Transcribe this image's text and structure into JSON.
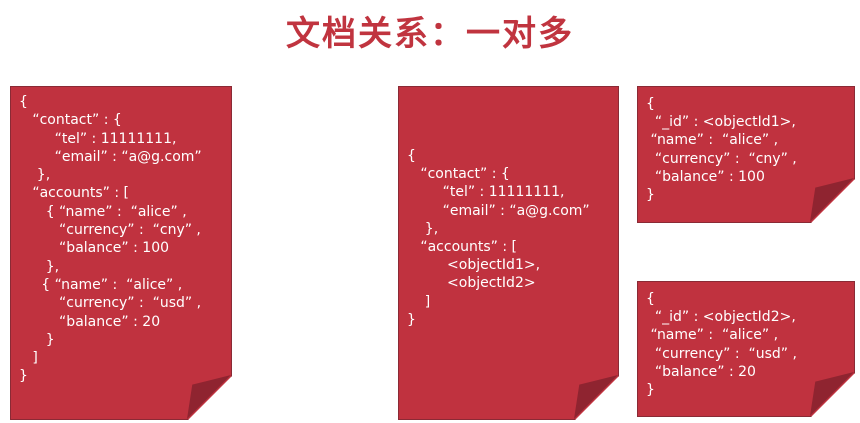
{
  "title": "文档关系：一对多",
  "colors": {
    "card": "#c0323f",
    "title": "#c0343f",
    "fold": "#8f2430"
  },
  "embedded_doc": {
    "lines": [
      "{",
      "   “contact” : {",
      "        “tel” : 11111111,",
      "        “email” : “a@g.com”",
      "    },",
      "   “accounts” : [",
      "      { “name” :  “alice” ,",
      "         “currency” :  “cny” ,",
      "         “balance” : 100",
      "      },",
      "     { “name” :  “alice” ,",
      "         “currency” :  “usd” ,",
      "         “balance” : 20",
      "      }",
      "   ]",
      "}"
    ]
  },
  "referencing_doc": {
    "lines": [
      "{",
      "   “contact” : {",
      "        “tel” : 11111111,",
      "        “email” : “a@g.com”",
      "    },",
      "   “accounts” : [",
      "         <objectId1>,",
      "         <objectId2>",
      "    ]",
      "}"
    ]
  },
  "account_docs": [
    {
      "lines": [
        "{",
        "  “_id” : <objectId1>,",
        " “name” :  “alice” ,",
        "  “currency” :  “cny” ,",
        "  “balance” : 100",
        "}"
      ]
    },
    {
      "lines": [
        "{",
        "  “_id” : <objectId2>,",
        " “name” :  “alice” ,",
        "  “currency” :  “usd” ,",
        "  “balance” : 20",
        "}"
      ]
    }
  ]
}
